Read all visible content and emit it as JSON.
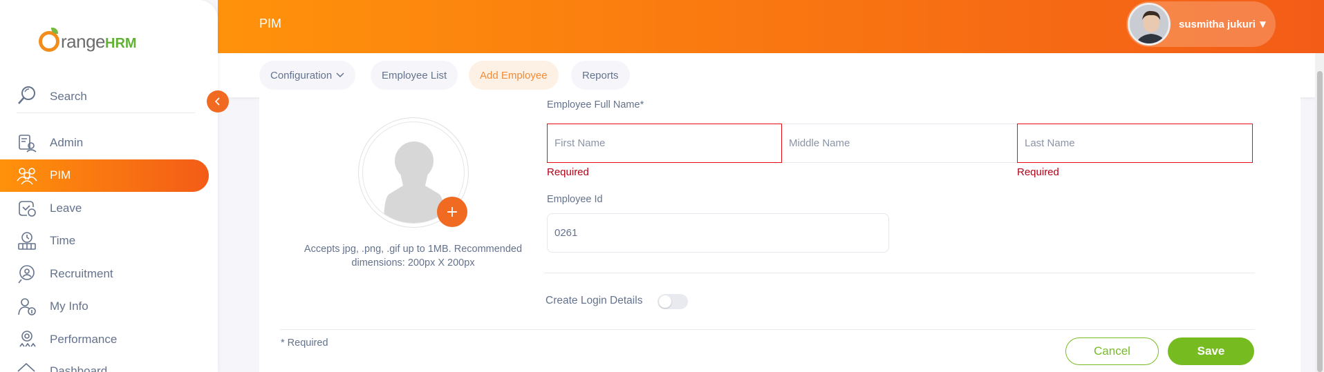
{
  "brand": {
    "text_main": "range",
    "text_hrm": "HRM"
  },
  "sidebar": {
    "search_label": "Search",
    "items": [
      {
        "label": "Admin",
        "icon": "admin-icon",
        "active": false
      },
      {
        "label": "PIM",
        "icon": "pim-icon",
        "active": true
      },
      {
        "label": "Leave",
        "icon": "leave-icon",
        "active": false
      },
      {
        "label": "Time",
        "icon": "time-icon",
        "active": false
      },
      {
        "label": "Recruitment",
        "icon": "recruitment-icon",
        "active": false
      },
      {
        "label": "My Info",
        "icon": "myinfo-icon",
        "active": false
      },
      {
        "label": "Performance",
        "icon": "performance-icon",
        "active": false
      },
      {
        "label": "Dashboard",
        "icon": "dashboard-icon",
        "active": false
      }
    ]
  },
  "header": {
    "title": "PIM",
    "user_name": "susmitha jukuri"
  },
  "tabs": [
    {
      "label": "Configuration",
      "has_dropdown": true,
      "active": false
    },
    {
      "label": "Employee List",
      "active": false
    },
    {
      "label": "Add Employee",
      "active": true
    },
    {
      "label": "Reports",
      "active": false
    }
  ],
  "form": {
    "full_name_label": "Employee Full Name*",
    "first_name_placeholder": "First Name",
    "middle_name_placeholder": "Middle Name",
    "last_name_placeholder": "Last Name",
    "first_name_error": "Required",
    "last_name_error": "Required",
    "employee_id_label": "Employee Id",
    "employee_id_value": "0261",
    "photo_hint": "Accepts jpg, .png, .gif up to 1MB. Recommended dimensions: 200px X 200px",
    "create_login_label": "Create Login Details",
    "create_login_enabled": false,
    "required_note": "* Required",
    "cancel_label": "Cancel",
    "save_label": "Save"
  },
  "colors": {
    "accent": "#f16a22",
    "primary_green": "#76bc21",
    "error": "#b50016"
  }
}
